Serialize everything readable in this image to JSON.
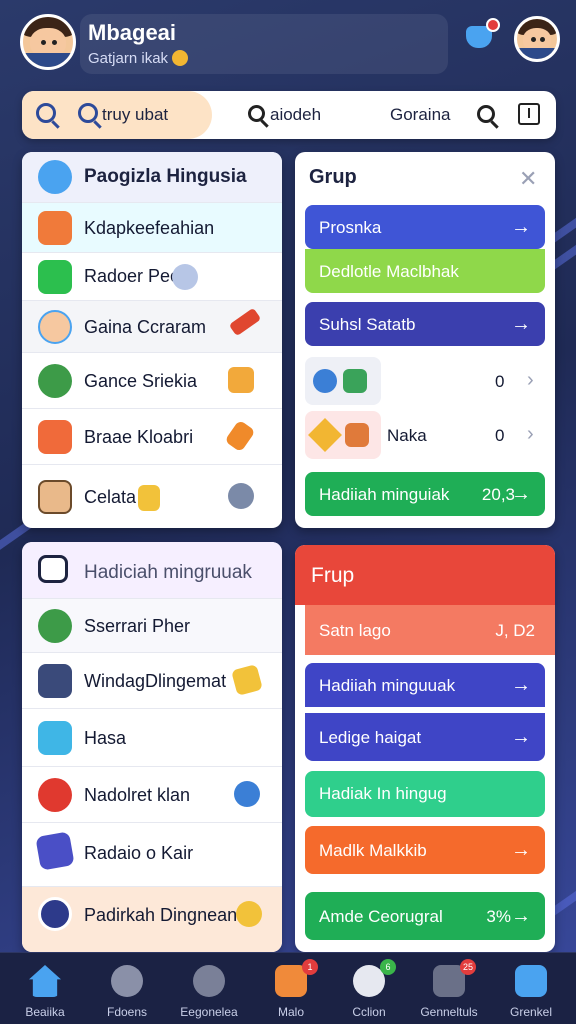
{
  "header": {
    "username": "Mbageai",
    "subtitle": "Gatjarn ikak"
  },
  "search": {
    "pill_text": "truy ubat",
    "middle_text": "aiodeh",
    "right_text": "Goraina"
  },
  "left_card": {
    "title": "Paogizla Hingusia",
    "items": [
      {
        "label": "Kdapkeefeahian",
        "icon": "fire-icon"
      },
      {
        "label": "Radoer Peo",
        "icon": "chart-icon"
      },
      {
        "label": "Gaina Ccraram",
        "icon": "girl-avatar-icon"
      },
      {
        "label": "Gance Sriekia",
        "icon": "turtle-icon"
      },
      {
        "label": "Braae Kloabri",
        "icon": "robot-icon"
      },
      {
        "label": "Celata",
        "icon": "man-avatar-icon"
      }
    ]
  },
  "group_card": {
    "title": "Grup",
    "buttons": [
      {
        "label": "Prosnka",
        "color": "#3f55d6"
      },
      {
        "label": "Dedlotle Maclbhak",
        "color": "#8fd84a"
      },
      {
        "label": "Suhsl Satatb",
        "color": "#3b3fae"
      }
    ],
    "rows": [
      {
        "label": "",
        "count": "0"
      },
      {
        "label": "Naka",
        "count": "0"
      }
    ],
    "footer_button": {
      "label": "Hadiiah minguiak",
      "value": "20,3",
      "color": "#1fae56"
    }
  },
  "lower_left_card": {
    "title": "Hadiciah mingruuak",
    "items": [
      {
        "label": "Sserrari Pher",
        "icon": "turtle-icon"
      },
      {
        "label": "WindagDlingemat",
        "icon": "console-icon"
      },
      {
        "label": "Hasa",
        "icon": "chick-icon"
      },
      {
        "label": "Nadolret klan",
        "icon": "crab-icon"
      },
      {
        "label": "Radaio o Kair",
        "icon": "phone-icon"
      }
    ],
    "footer": {
      "label": "Padirkah Dingnean"
    }
  },
  "frup_card": {
    "title": "Frup",
    "banner": {
      "label": "Satn lago",
      "value": "J, D2"
    },
    "buttons": [
      {
        "label": "Hadiiah minguuak",
        "color": "#3f45c6"
      },
      {
        "label": "Ledige haigat",
        "color": "#3f45c6"
      },
      {
        "label": "Hadiak In hingug",
        "color": "#2fcf8c"
      },
      {
        "label": "Madlk Malkkib",
        "color": "#f56a2c"
      },
      {
        "label": "Amde Ceorugral",
        "value": "3%",
        "color": "#1fae56"
      }
    ]
  },
  "bottom_nav": [
    {
      "label": "Beaiika",
      "icon": "home-icon",
      "badge": ""
    },
    {
      "label": "Fdoens",
      "icon": "chat-icon",
      "badge": ""
    },
    {
      "label": "Eegonelea",
      "icon": "robot-icon",
      "badge": ""
    },
    {
      "label": "Malo",
      "icon": "gift-icon",
      "badge": "1"
    },
    {
      "label": "Cclion",
      "icon": "face-icon",
      "badge": "6"
    },
    {
      "label": "Genneltuls",
      "icon": "camera-icon",
      "badge": "25"
    },
    {
      "label": "Grenkel",
      "icon": "profile-icon",
      "badge": ""
    }
  ]
}
